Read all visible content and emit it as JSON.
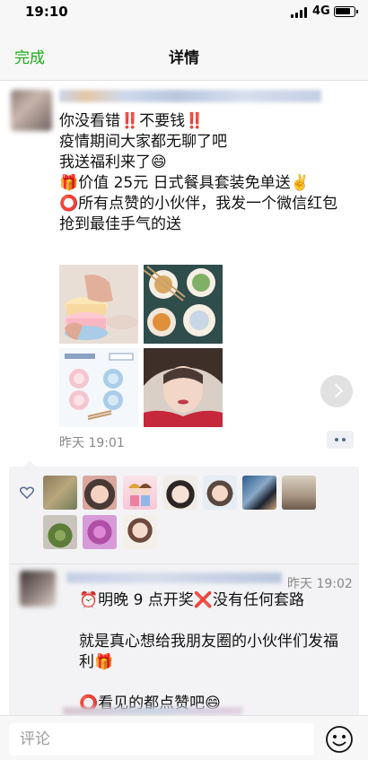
{
  "status_bar": {
    "time": "19:10",
    "network": "4G",
    "battery_level": 0.85
  },
  "nav": {
    "back_label": "完成",
    "title": "详情"
  },
  "post": {
    "lines": [
      "你没看错‼️不要钱‼️",
      "疫情期间大家都无聊了吧",
      "我送福利来了😄",
      "🎁价值 25元 日式餐具套装免单送✌️",
      "⭕所有点赞的小伙伴，我发一个微信红包",
      "抢到最佳手气的送"
    ],
    "images": [
      "bowls-photo",
      "dishes-photo",
      "product-info-photo",
      "selfie-photo"
    ],
    "time": "昨天 19:01"
  },
  "likes": {
    "icon": "heart-icon",
    "avatar_count": 11
  },
  "comment": {
    "time": "昨天 19:02",
    "line1_prefix": "⏰明晚 9 点开奖",
    "line1_suffix": "❌没有任何套路",
    "line2": "就是真心想给我朋友圈的小伙伴们发福利🎁",
    "line3": "⭕看见的都点赞吧😄"
  },
  "comment_bar": {
    "placeholder": "评论",
    "emoji_icon": "smiley-icon"
  },
  "colors": {
    "accent_green": "#1aad19",
    "link_blue": "#576b95",
    "panel_bg": "#f3f3f5"
  }
}
